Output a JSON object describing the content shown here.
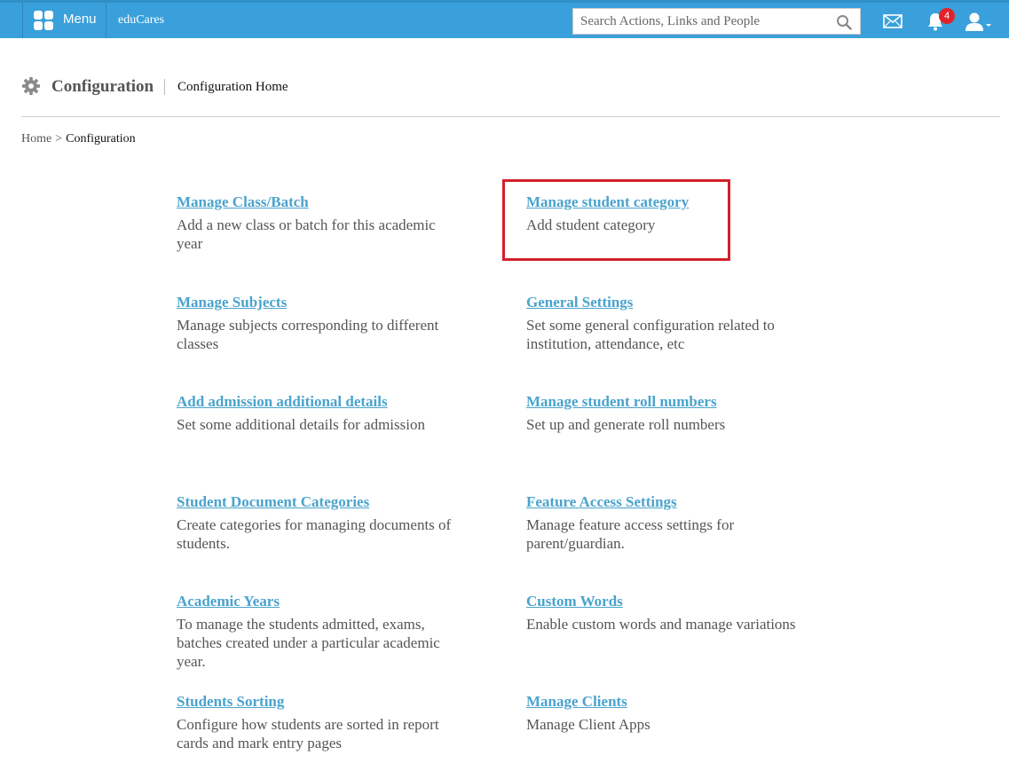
{
  "topbar": {
    "menu_label": "Menu",
    "brand": "eduCares",
    "search_placeholder": "Search Actions, Links and People",
    "notification_count": "4",
    "accent_color": "#3aa0db"
  },
  "header": {
    "title": "Configuration",
    "subtitle": "Configuration Home"
  },
  "breadcrumb": {
    "home": "Home",
    "separator": ">",
    "current": "Configuration"
  },
  "items": [
    {
      "title": "Manage Class/Batch",
      "desc": "Add a new class or batch for this academic year"
    },
    {
      "title": "Manage student category",
      "desc": "Add student category"
    },
    {
      "title": "Manage Subjects",
      "desc": "Manage subjects corresponding to different classes"
    },
    {
      "title": "General Settings",
      "desc": "Set some general configuration related to institution, attendance, etc"
    },
    {
      "title": "Add admission additional details",
      "desc": "Set some additional details for admission"
    },
    {
      "title": "Manage student roll numbers",
      "desc": "Set up and generate roll numbers"
    },
    {
      "title": "Student Document Categories",
      "desc": "Create categories for managing documents of students."
    },
    {
      "title": "Feature Access Settings",
      "desc": "Manage feature access settings for parent/guardian."
    },
    {
      "title": "Academic Years",
      "desc": "To manage the students admitted, exams, batches created under a particular academic year."
    },
    {
      "title": "Custom Words",
      "desc": "Enable custom words and manage variations"
    },
    {
      "title": "Students Sorting",
      "desc": "Configure how students are sorted in report cards and mark entry pages"
    },
    {
      "title": "Manage Clients",
      "desc": "Manage Client Apps"
    }
  ],
  "highlight_color": "#d4202a"
}
